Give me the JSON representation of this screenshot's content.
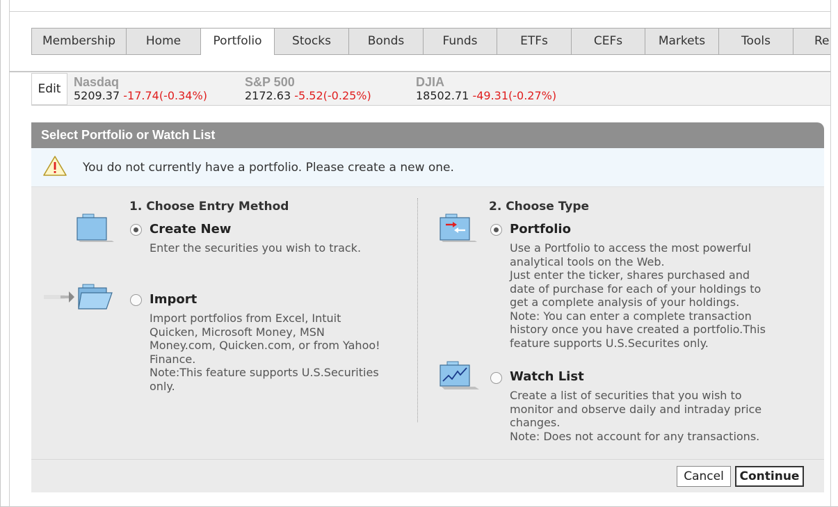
{
  "tabs": [
    {
      "label": "Membership",
      "active": false
    },
    {
      "label": "Home",
      "active": false
    },
    {
      "label": "Portfolio",
      "active": true
    },
    {
      "label": "Stocks",
      "active": false
    },
    {
      "label": "Bonds",
      "active": false
    },
    {
      "label": "Funds",
      "active": false
    },
    {
      "label": "ETFs",
      "active": false
    },
    {
      "label": "CEFs",
      "active": false
    },
    {
      "label": "Markets",
      "active": false
    },
    {
      "label": "Tools",
      "active": false
    },
    {
      "label": "Re",
      "active": false
    }
  ],
  "ticker": {
    "edit_label": "Edit",
    "indices": [
      {
        "name": "Nasdaq",
        "value": "5209.37",
        "change": "-17.74(-0.34%)"
      },
      {
        "name": "S&P 500",
        "value": "2172.63",
        "change": "-5.52(-0.25%)"
      },
      {
        "name": "DJIA",
        "value": "18502.71",
        "change": "-49.31(-0.27%)"
      }
    ]
  },
  "panel": {
    "title": "Select Portfolio or Watch List",
    "notice": "You do not currently have a portfolio. Please create a new one."
  },
  "entry": {
    "heading": "1. Choose Entry Method",
    "create": {
      "title": "Create New",
      "desc": "Enter the securities you wish to track.",
      "selected": true
    },
    "import": {
      "title": "Import",
      "desc_lines": [
        "Import portfolios from Excel, Intuit",
        "Quicken, Microsoft Money, MSN",
        "Money.com, Quicken.com, or from Yahoo!",
        "Finance.",
        "Note:This feature supports U.S.Securities",
        "only."
      ],
      "selected": false
    }
  },
  "type": {
    "heading": "2. Choose Type",
    "portfolio": {
      "title": "Portfolio",
      "desc_lines": [
        "Use a Portfolio to access the most powerful",
        "analytical tools on the Web.",
        "Just enter the ticker, shares purchased and",
        "date of purchase for each of your holdings to",
        "get a complete analysis of your holdings.",
        "Note: You can enter a complete transaction",
        "history once you have created a portfolio.This",
        "feature supports U.S.Securites only."
      ],
      "selected": true
    },
    "watchlist": {
      "title": "Watch List",
      "desc_lines": [
        "Create a list of securities that you wish to",
        "monitor and observe daily and intraday price",
        "changes.",
        "Note: Does not account for any transactions."
      ],
      "selected": false
    }
  },
  "footer": {
    "cancel_label": "Cancel",
    "continue_label": "Continue"
  },
  "colors": {
    "negative": "#e01e1e",
    "panel_header": "#8f8f8f",
    "folder_blue": "#8ec4ec"
  }
}
